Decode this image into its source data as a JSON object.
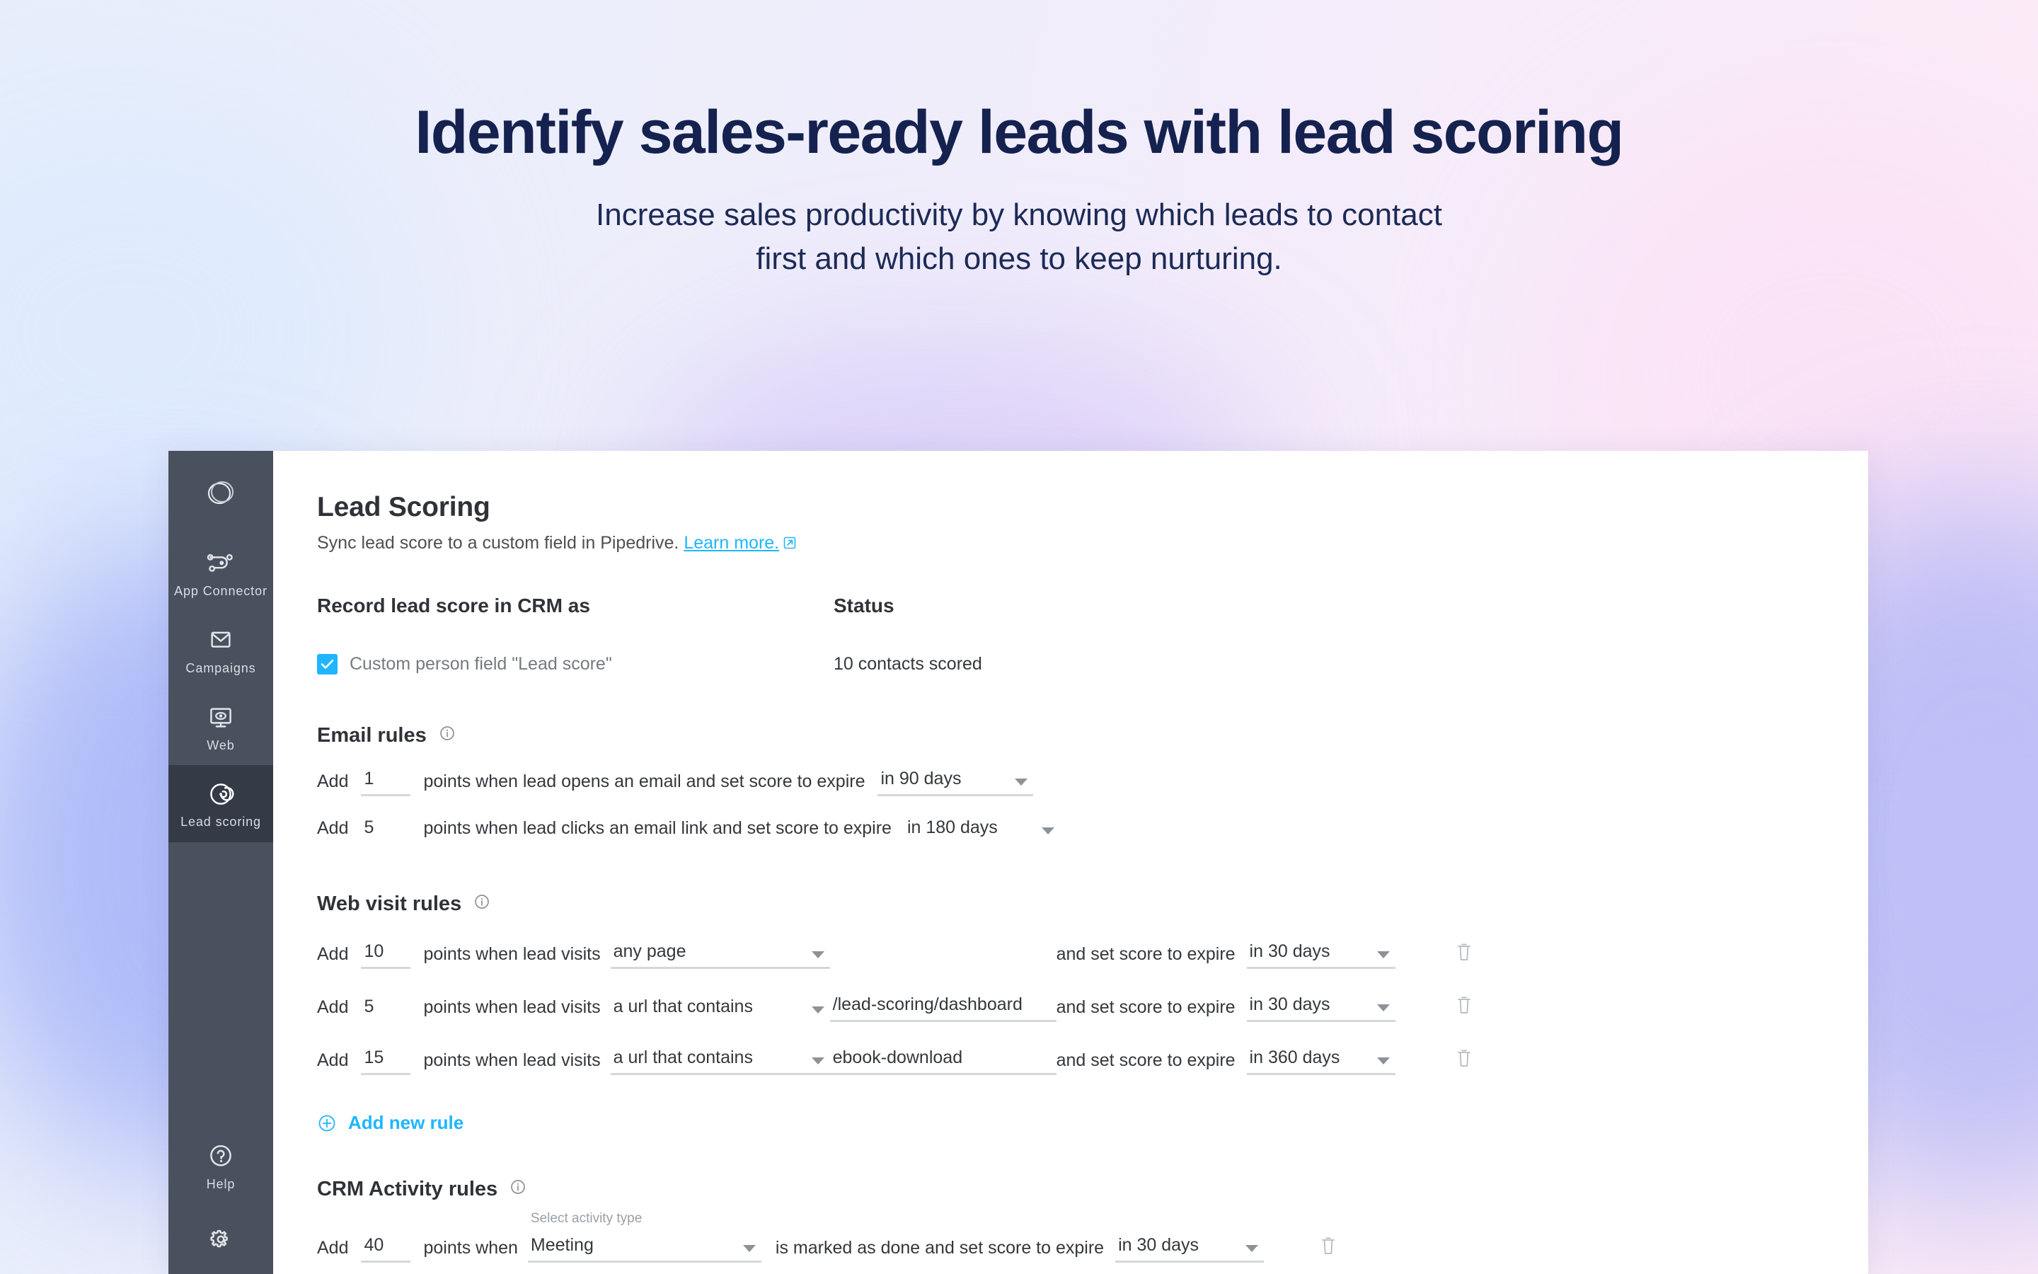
{
  "hero": {
    "title": "Identify sales-ready leads with lead scoring",
    "subtitle_line1": "Increase sales productivity by knowing which leads to contact",
    "subtitle_line2": "first and which ones to keep nurturing."
  },
  "colors": {
    "accent": "#1fb6ff",
    "sidebar_bg": "#4a515e",
    "sidebar_active_bg": "#343a46",
    "heading": "#2f3338",
    "hero_text": "#15224f"
  },
  "sidebar": {
    "logo_icon": "circles-logo-icon",
    "items": [
      {
        "label": "App Connector",
        "icon": "nodes-connector-icon",
        "active": false
      },
      {
        "label": "Campaigns",
        "icon": "envelope-icon",
        "active": false
      },
      {
        "label": "Web",
        "icon": "monitor-eye-icon",
        "active": false
      },
      {
        "label": "Lead scoring",
        "icon": "radar-target-icon",
        "active": true
      }
    ],
    "bottom_items": [
      {
        "label": "Help",
        "icon": "question-circle-icon"
      },
      {
        "label": "",
        "icon": "gear-icon"
      }
    ]
  },
  "page": {
    "title": "Lead Scoring",
    "subtitle_prefix": "Sync lead score to a custom field in Pipedrive.",
    "subtitle_link": "Learn more.",
    "external_link_icon": "external-link-icon"
  },
  "record_column": {
    "heading": "Record lead score in CRM as",
    "checkbox_checked": true,
    "checkbox_label": "Custom person field \"Lead score\""
  },
  "status_column": {
    "heading": "Status",
    "value": "10 contacts scored"
  },
  "email_rules": {
    "heading": "Email rules",
    "info_icon": "info-circle-icon",
    "rows": [
      {
        "add_label": "Add",
        "points": "1",
        "mid_label": "points when lead opens an email and set score to expire",
        "expire": "in 90 days"
      },
      {
        "add_label": "Add",
        "points": "5",
        "mid_label": "points when lead clicks an email link and set score to expire",
        "expire": "in 180 days"
      }
    ]
  },
  "web_visit_rules": {
    "heading": "Web visit rules",
    "info_icon": "info-circle-icon",
    "rows": [
      {
        "add_label": "Add",
        "points": "10",
        "mid_label": "points when lead visits",
        "target": "any page",
        "url_value": "",
        "expire_label": "and set score to expire",
        "expire": "in 30 days",
        "delete_icon": "trash-icon"
      },
      {
        "add_label": "Add",
        "points": "5",
        "mid_label": "points when lead visits",
        "target": "a url that contains",
        "url_value": "/lead-scoring/dashboard",
        "expire_label": "and set score to expire",
        "expire": "in 30 days",
        "delete_icon": "trash-icon"
      },
      {
        "add_label": "Add",
        "points": "15",
        "mid_label": "points when lead visits",
        "target": "a url that contains",
        "url_value": "ebook-download",
        "expire_label": "and set score to expire",
        "expire": "in 360 days",
        "delete_icon": "trash-icon"
      }
    ],
    "add_new_rule": "Add new rule",
    "add_new_rule_icon": "plus-circle-icon"
  },
  "crm_activity_rules": {
    "heading": "CRM Activity rules",
    "info_icon": "info-circle-icon",
    "rows": [
      {
        "add_label": "Add",
        "points": "40",
        "mid_label": "points when",
        "activity_float_label": "Select activity type",
        "activity": "Meeting",
        "tail_label": "is marked as done and set score to expire",
        "expire": "in 30 days",
        "delete_icon": "trash-icon"
      }
    ]
  }
}
